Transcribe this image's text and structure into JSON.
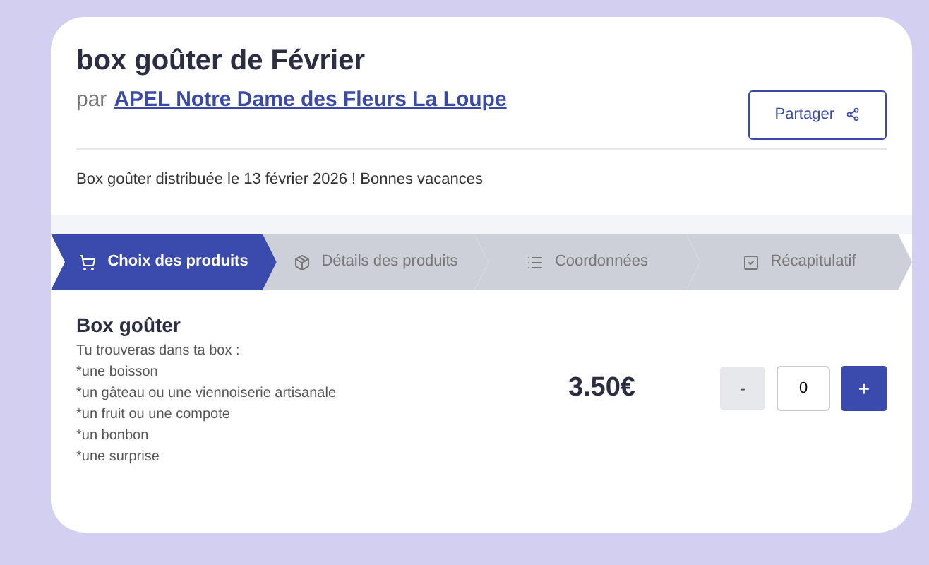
{
  "header": {
    "title": "box goûter de Février",
    "by_prefix": "par",
    "organizer_link": "APEL Notre Dame des Fleurs La Loupe",
    "share_button": "Partager"
  },
  "description": "Box goûter distribuée le 13 février 2026 ! Bonnes vacances",
  "steps": [
    {
      "label": "Choix des produits",
      "selected": true
    },
    {
      "label": "Détails des produits",
      "selected": false
    },
    {
      "label": "Coordonnées",
      "selected": false
    },
    {
      "label": "Récapitulatif",
      "selected": false
    }
  ],
  "product": {
    "name": "Box goûter",
    "lines": [
      "Tu trouveras dans ta box :",
      "*une boisson",
      "*un gâteau ou une viennoiserie artisanale",
      "*un fruit ou une compote",
      "*un bonbon",
      "*une surprise"
    ],
    "price": "3.50€",
    "minus": "-",
    "quantity": "0",
    "plus": "+"
  }
}
